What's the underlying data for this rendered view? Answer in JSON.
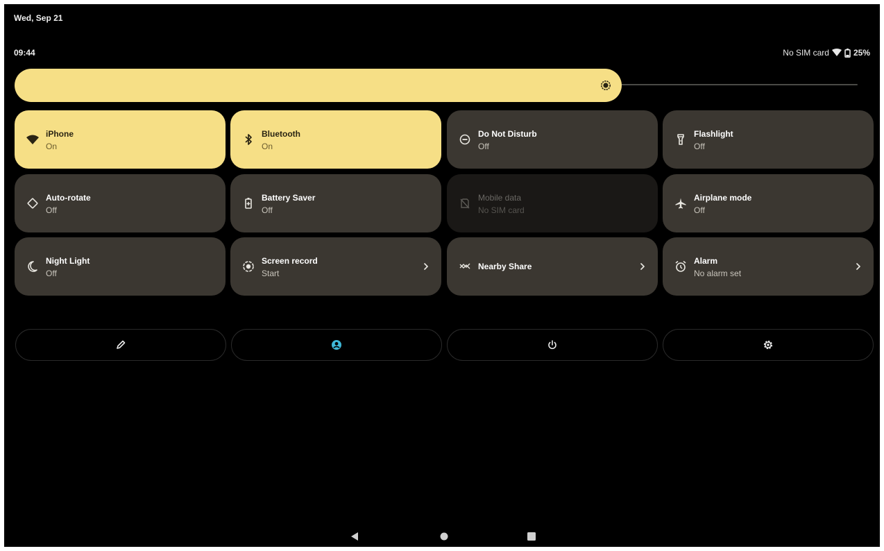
{
  "header": {
    "date": "Wed, Sep 21",
    "time": "09:44",
    "sim_status": "No SIM card",
    "battery_percent": "25%"
  },
  "brightness": {
    "level": 0.72,
    "icon": "brightness-icon",
    "color": "#f6df86"
  },
  "tiles": [
    {
      "label": "iPhone",
      "sub": "On",
      "icon": "wifi-icon",
      "state": "active"
    },
    {
      "label": "Bluetooth",
      "sub": "On",
      "icon": "bluetooth-icon",
      "state": "active"
    },
    {
      "label": "Do Not Disturb",
      "sub": "Off",
      "icon": "do-not-disturb-icon",
      "state": "inactive"
    },
    {
      "label": "Flashlight",
      "sub": "Off",
      "icon": "flashlight-icon",
      "state": "inactive"
    },
    {
      "label": "Auto-rotate",
      "sub": "Off",
      "icon": "auto-rotate-icon",
      "state": "inactive"
    },
    {
      "label": "Battery Saver",
      "sub": "Off",
      "icon": "battery-saver-icon",
      "state": "inactive"
    },
    {
      "label": "Mobile data",
      "sub": "No SIM card",
      "icon": "mobile-data-off-icon",
      "state": "disabled"
    },
    {
      "label": "Airplane mode",
      "sub": "Off",
      "icon": "airplane-icon",
      "state": "inactive"
    },
    {
      "label": "Night Light",
      "sub": "Off",
      "icon": "night-light-icon",
      "state": "inactive"
    },
    {
      "label": "Screen record",
      "sub": "Start",
      "icon": "screen-record-icon",
      "state": "inactive",
      "chevron": true
    },
    {
      "label": "Nearby Share",
      "sub": "",
      "icon": "nearby-share-icon",
      "state": "inactive",
      "chevron": true
    },
    {
      "label": "Alarm",
      "sub": "No alarm set",
      "icon": "alarm-icon",
      "state": "inactive",
      "chevron": true
    }
  ],
  "actions": [
    {
      "icon": "edit-pencil-icon"
    },
    {
      "icon": "user-account-icon",
      "color": "#3fb8d8"
    },
    {
      "icon": "power-icon"
    },
    {
      "icon": "settings-gear-icon"
    }
  ],
  "navbar": [
    {
      "icon": "back-icon"
    },
    {
      "icon": "home-icon"
    },
    {
      "icon": "recents-icon"
    }
  ],
  "colors": {
    "background": "#000000",
    "tile_active": "#f6df86",
    "tile_inactive": "#3b3731",
    "tile_disabled": "#1a1816"
  }
}
